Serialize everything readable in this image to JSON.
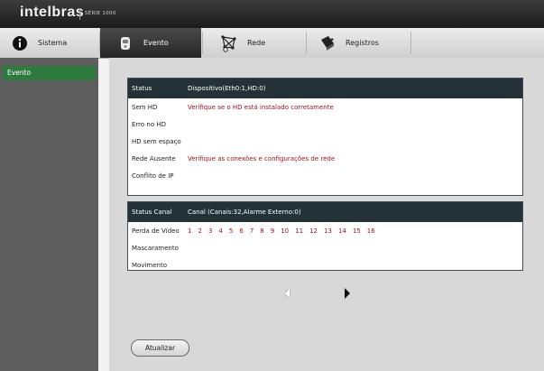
{
  "brand": {
    "logo": "intelbras",
    "series": "SÉRIE 1000"
  },
  "tabs": [
    {
      "label": "Sistema",
      "icon": "info-icon"
    },
    {
      "label": "Evento",
      "icon": "alarm-device-icon",
      "active": true
    },
    {
      "label": "Rede",
      "icon": "network-icon"
    },
    {
      "label": "Registros",
      "icon": "registry-icon"
    }
  ],
  "sidebar": {
    "items": [
      {
        "label": "Evento",
        "selected": true
      }
    ]
  },
  "status_panel": {
    "header_key": "Status",
    "header_value": "Dispositivo(Eth0:1,HD:0)",
    "rows": [
      {
        "label": "Sem HD",
        "value": "Verifique se o HD está instalado corretamente"
      },
      {
        "label": "Erro no HD",
        "value": ""
      },
      {
        "label": "HD sem espaço",
        "value": ""
      },
      {
        "label": "Rede Ausente",
        "value": "Verifique as conexões e configurações de rede"
      },
      {
        "label": "Conflito de IP",
        "value": ""
      }
    ]
  },
  "channel_panel": {
    "header_key": "Status Canal",
    "header_value": "Canal (Canais:32,Alarme Externo:0)",
    "rows": [
      {
        "label": "Perda de Vídeo",
        "channels": [
          "1",
          "2",
          "3",
          "4",
          "5",
          "6",
          "7",
          "8",
          "9",
          "10",
          "11",
          "12",
          "13",
          "14",
          "15",
          "16"
        ]
      },
      {
        "label": "Mascaramento",
        "channels": []
      },
      {
        "label": "Movimento",
        "channels": []
      }
    ]
  },
  "actions": {
    "refresh_label": "Atualizar"
  },
  "colors": {
    "accent_green": "#2f7a3e",
    "panel_header": "#243237",
    "alert_red": "#a1121a"
  }
}
